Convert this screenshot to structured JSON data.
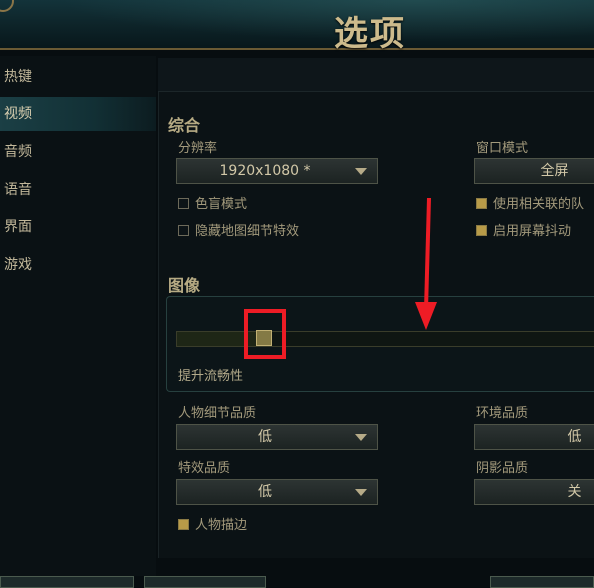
{
  "header": {
    "title": "选项"
  },
  "sidebar": {
    "items": [
      {
        "label": "热键"
      },
      {
        "label": "视频",
        "active": true
      },
      {
        "label": "音频"
      },
      {
        "label": "语音"
      },
      {
        "label": "界面"
      },
      {
        "label": "游戏"
      }
    ]
  },
  "general": {
    "title": "综合",
    "resolution": {
      "label": "分辨率",
      "value": "1920x1080 *"
    },
    "window_mode": {
      "label": "窗口模式",
      "value": "全屏"
    },
    "colorblind": {
      "label": "色盲模式",
      "checked": false
    },
    "hide_map_detail": {
      "label": "隐藏地图细节特效",
      "checked": false
    },
    "use_related": {
      "label": "使用相关联的队",
      "checked": true
    },
    "screen_shake": {
      "label": "启用屏幕抖动",
      "checked": true
    }
  },
  "graphics": {
    "title": "图像",
    "slider": {
      "caption": "提升流畅性",
      "level": 0.2
    },
    "character_quality": {
      "label": "人物细节品质",
      "value": "低"
    },
    "environment_quality": {
      "label": "环境品质",
      "value": "低"
    },
    "effects_quality": {
      "label": "特效品质",
      "value": "低"
    },
    "shadow_quality": {
      "label": "阴影品质",
      "value": "关"
    },
    "character_outline": {
      "label": "人物描边",
      "checked": true
    }
  },
  "colors": {
    "accent_gold": "#b89b48",
    "highlight_red": "#ee1c25",
    "active_nav": "#1b3f45"
  }
}
